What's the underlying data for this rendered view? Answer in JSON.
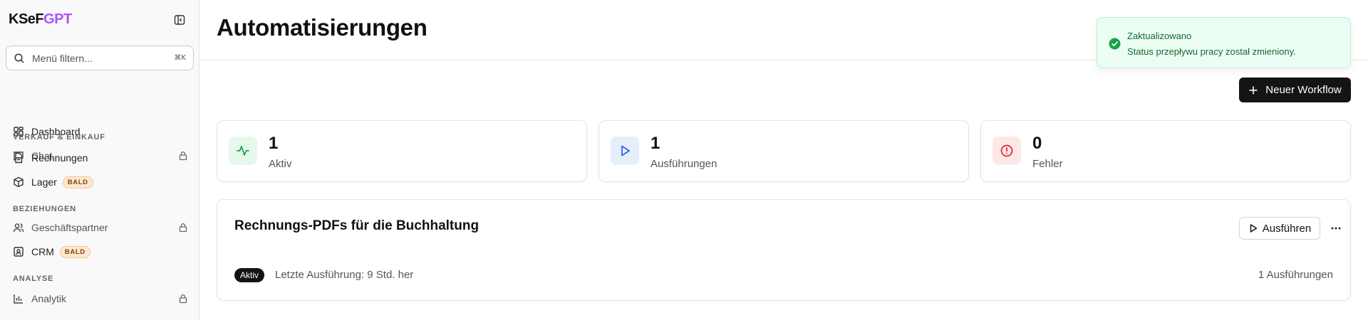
{
  "logo": {
    "part1": "KSeF",
    "part2": "GPT"
  },
  "search": {
    "placeholder": "Menü filtern...",
    "shortcut": "⌘K"
  },
  "nav": {
    "dashboard": "Dashboard",
    "chat": "Chat",
    "section_sales": "VERKAUF & EINKAUF",
    "invoices": "Rechnungen",
    "stock": "Lager",
    "section_relations": "BEZIEHUNGEN",
    "partners": "Geschäftspartner",
    "crm": "CRM",
    "section_analysis": "ANALYSE",
    "analytics": "Analytik",
    "soon_badge": "BALD"
  },
  "page": {
    "title": "Automatisierungen"
  },
  "actions": {
    "new_workflow": "Neuer Workflow"
  },
  "stats": [
    {
      "value": "1",
      "label": "Aktiv",
      "color": "#16a34a",
      "bg": "#e6f7ec",
      "icon": "activity-icon"
    },
    {
      "value": "1",
      "label": "Ausführungen",
      "color": "#2563eb",
      "bg": "#e6eefc",
      "icon": "play-icon"
    },
    {
      "value": "0",
      "label": "Fehler",
      "color": "#dc2626",
      "bg": "#fde8e8",
      "icon": "alert-circle-icon"
    }
  ],
  "workflow": {
    "title": "Rechnungs-PDFs für die Buchhaltung",
    "run_label": "Ausführen",
    "status": "Aktiv",
    "last_run": "Letzte Ausführung: 9 Std. her",
    "runs": "1 Ausführungen"
  },
  "toast": {
    "title": "Zaktualizowano",
    "message": "Status przepływu pracy został zmieniony."
  },
  "colors": {
    "accent": "#a855f7",
    "primary_button": "#141414",
    "success": "#16a34a"
  }
}
